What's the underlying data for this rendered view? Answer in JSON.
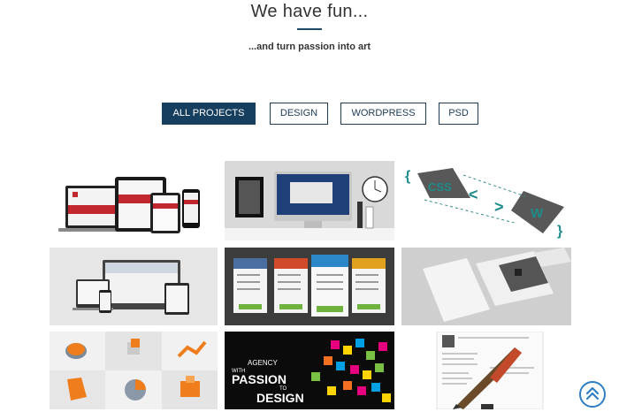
{
  "section": {
    "title": "We have fun...",
    "subtitle": "...and turn passion into art"
  },
  "filters": [
    {
      "label": "ALL PROJECTS",
      "active": true
    },
    {
      "label": "DESIGN",
      "active": false
    },
    {
      "label": "WORDPRESS",
      "active": false
    },
    {
      "label": "PSD",
      "active": false
    }
  ],
  "tiles": {
    "tile6": {
      "agency": "AGENCY",
      "with": "WITH",
      "passion": "PASSION",
      "to": "TO",
      "design": "DESIGN"
    },
    "tile2": {
      "css": "CSS",
      "w": "W",
      "lt": "<",
      "gt": ">",
      "lbrace": "{",
      "rbrace": "}"
    }
  },
  "scroll_top": {
    "icon": "double-chevron-up-icon"
  }
}
